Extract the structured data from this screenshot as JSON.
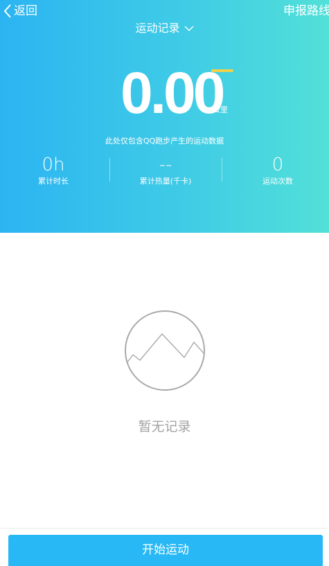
{
  "nav": {
    "back_label": "返回",
    "report_label": "申报路线"
  },
  "record_selector": {
    "title": "运动记录"
  },
  "distance": {
    "value": "0.00",
    "unit": "公里"
  },
  "note": "此处仅包含QQ跑步产生的运动数据",
  "stats": {
    "duration": {
      "value": "0h",
      "label": "累计时长"
    },
    "calories": {
      "value": "--",
      "label": "累计热量(千卡)"
    },
    "count": {
      "value": "0",
      "label": "运动次数"
    }
  },
  "empty_state": {
    "icon": "mountain-icon",
    "text": "暂无记录"
  },
  "start_button_label": "开始运动",
  "colors": {
    "gradient_start": "#2bb4f2",
    "gradient_end": "#52e0d8",
    "accent_underline": "#f3d04a",
    "button": "#27b8f5",
    "empty_text": "#a3a3a3"
  }
}
